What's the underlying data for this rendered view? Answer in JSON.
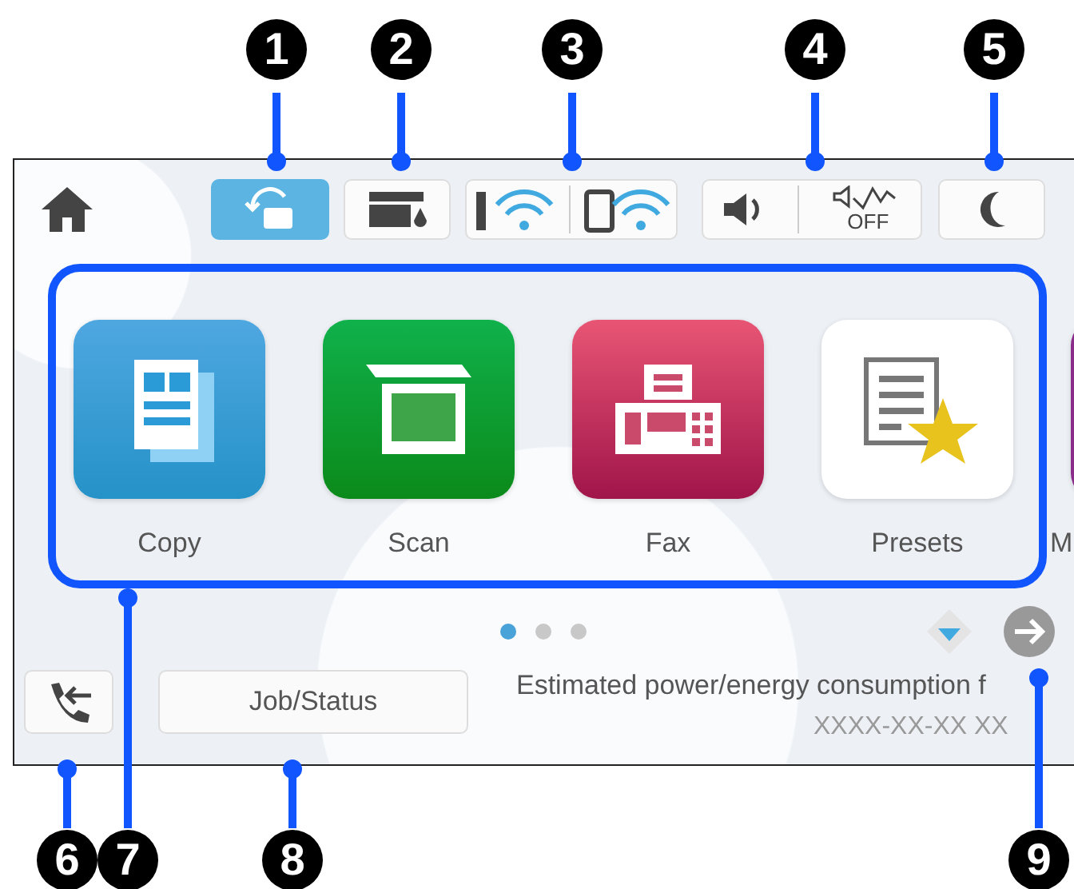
{
  "callouts_top": [
    {
      "number": "1"
    },
    {
      "number": "2"
    },
    {
      "number": "3"
    },
    {
      "number": "4"
    },
    {
      "number": "5"
    }
  ],
  "status_bar": [
    {
      "kind": "transfer",
      "highlighted": true
    },
    {
      "kind": "ink",
      "highlighted": false
    },
    {
      "kind": "network",
      "highlighted": false
    },
    {
      "kind": "sound",
      "highlighted": false,
      "off_label": "OFF"
    },
    {
      "kind": "sleep",
      "highlighted": false
    }
  ],
  "apps": [
    {
      "kind": "copy",
      "label": "Copy"
    },
    {
      "kind": "scan",
      "label": "Scan"
    },
    {
      "kind": "fax",
      "label": "Fax"
    },
    {
      "kind": "presets",
      "label": "Presets"
    },
    {
      "kind": "more",
      "label": "M"
    }
  ],
  "page_dots": [
    {
      "selected": true
    },
    {
      "selected": false
    },
    {
      "selected": false
    }
  ],
  "job_status_button": "Job/Status",
  "notice": {
    "text": "Estimated power/energy consumption f",
    "date": "XXXX-XX-XX XX"
  },
  "callouts_bottom": [
    {
      "number": "6"
    },
    {
      "number": "7"
    },
    {
      "number": "8"
    },
    {
      "number": "9"
    }
  ]
}
